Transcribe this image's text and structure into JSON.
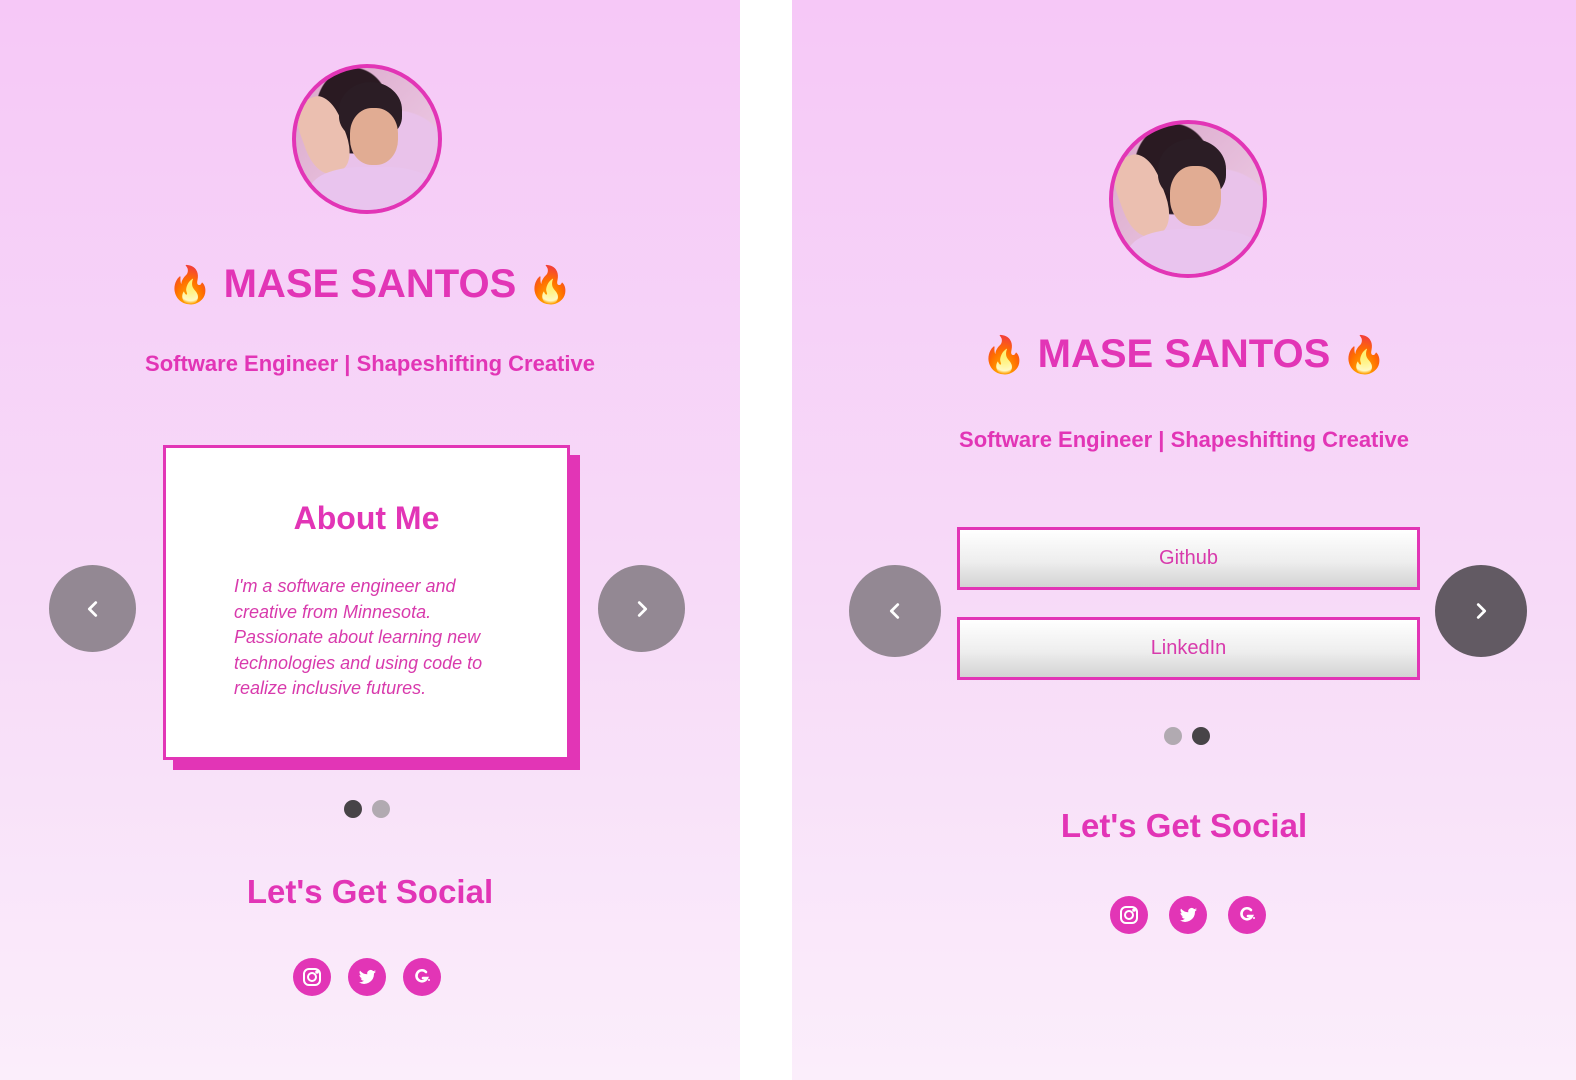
{
  "left": {
    "profile": {
      "name": "MASE SANTOS",
      "fire_emoji": "🔥",
      "subtitle": "Software Engineer | Shapeshifting Creative"
    },
    "about": {
      "title": "About Me",
      "text": "I'm a software engineer and creative from Minnesota. Passionate about learning new technologies and using code to realize inclusive futures."
    },
    "carousel": {
      "slides": 2,
      "active": 1
    },
    "social": {
      "title": "Let's Get Social",
      "icons": [
        "instagram-icon",
        "twitter-icon",
        "glitch-icon"
      ]
    }
  },
  "right": {
    "profile": {
      "name": "MASE SANTOS",
      "fire_emoji": "🔥",
      "subtitle": "Software Engineer | Shapeshifting Creative"
    },
    "links": [
      {
        "label": "Github"
      },
      {
        "label": "LinkedIn"
      }
    ],
    "carousel": {
      "slides": 2,
      "active": 2
    },
    "social": {
      "title": "Let's Get Social",
      "icons": [
        "instagram-icon",
        "twitter-icon",
        "glitch-icon"
      ]
    }
  },
  "colors": {
    "accent": "#e235b6",
    "nav_button": "#938893",
    "nav_button_active": "#625a63",
    "dot_inactive": "#b1aab1",
    "dot_active": "#474447"
  }
}
